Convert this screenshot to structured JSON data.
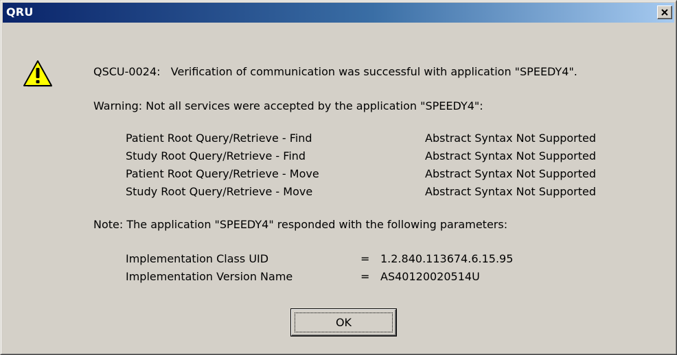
{
  "window": {
    "title": "QRU"
  },
  "message": {
    "status_line": "QSCU-0024:   Verification of communication was successful with application \"SPEEDY4\".",
    "warning_line": "Warning: Not all services were accepted by the application \"SPEEDY4\":",
    "services": [
      {
        "name": "Patient Root Query/Retrieve - Find",
        "status": "Abstract Syntax Not Supported"
      },
      {
        "name": "Study Root Query/Retrieve - Find",
        "status": "Abstract Syntax Not Supported"
      },
      {
        "name": "Patient Root Query/Retrieve - Move",
        "status": "Abstract Syntax Not Supported"
      },
      {
        "name": "Study Root Query/Retrieve - Move",
        "status": "Abstract Syntax Not Supported"
      }
    ],
    "note_line": "Note: The application \"SPEEDY4\" responded with the following parameters:",
    "parameters": [
      {
        "name": "Implementation Class UID",
        "sep": "=",
        "value": "1.2.840.113674.6.15.95"
      },
      {
        "name": "Implementation Version Name",
        "sep": "=",
        "value": "AS40120020514U"
      }
    ]
  },
  "buttons": {
    "ok_label": "OK"
  },
  "icons": {
    "warning": "warning-icon",
    "close": "close-icon"
  },
  "colors": {
    "title_gradient_start": "#0a246a",
    "title_gradient_end": "#a6caf0",
    "dialog_bg": "#d4d0c8",
    "warning_yellow": "#ffff00"
  }
}
